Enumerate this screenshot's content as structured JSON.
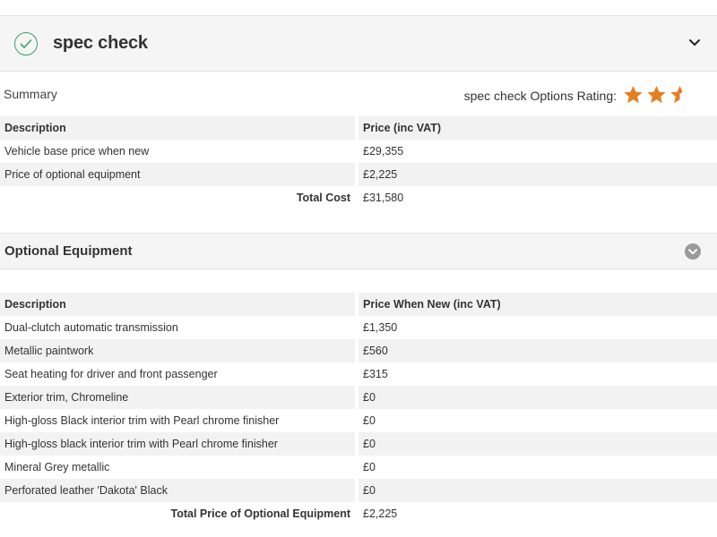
{
  "spec_check": {
    "title": "spec check",
    "summary_label": "Summary",
    "rating_label": "spec check Options Rating:",
    "rating_stars": 2.5,
    "rating_max": 3,
    "star_color": "#e67e22",
    "accent_color": "#3aa36a",
    "icons": [
      "check-icon",
      "chevron-down-icon",
      "star-icon",
      "star-half-icon"
    ]
  },
  "summary_table": {
    "headers": [
      "Description",
      "Price (inc VAT)"
    ],
    "rows": [
      {
        "description": "Vehicle base price when new",
        "price": "£29,355"
      },
      {
        "description": "Price of optional equipment",
        "price": "£2,225"
      }
    ],
    "total_label": "Total Cost",
    "total_value": "£31,580"
  },
  "optional_equipment": {
    "title": "Optional Equipment",
    "headers": [
      "Description",
      "Price When New (inc VAT)"
    ],
    "rows": [
      {
        "description": "Dual-clutch automatic transmission",
        "price": "£1,350"
      },
      {
        "description": "Metallic paintwork",
        "price": "£560"
      },
      {
        "description": "Seat heating for driver and front passenger",
        "price": "£315"
      },
      {
        "description": "Exterior trim, Chromeline",
        "price": "£0"
      },
      {
        "description": "High-gloss Black interior trim with Pearl chrome finisher",
        "price": "£0"
      },
      {
        "description": "High-gloss black interior trim with Pearl chrome finisher",
        "price": "£0"
      },
      {
        "description": "Mineral Grey metallic",
        "price": "£0"
      },
      {
        "description": "Perforated leather 'Dakota' Black",
        "price": "£0"
      }
    ],
    "total_label": "Total Price of Optional Equipment",
    "total_value": "£2,225"
  }
}
